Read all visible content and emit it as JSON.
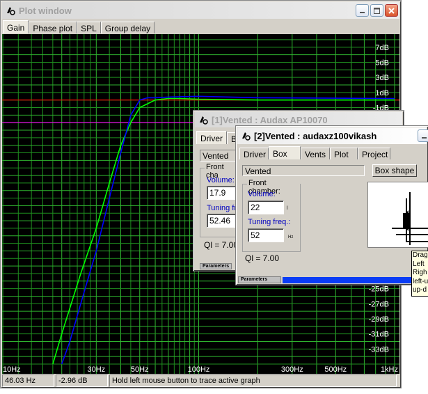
{
  "plot_window": {
    "title": "Plot window",
    "tabs": [
      "Gain",
      "Phase plot",
      "SPL",
      "Group delay"
    ],
    "y_ticks": [
      "7dB",
      "5dB",
      "3dB",
      "1dB",
      "-1dB",
      "-25dB",
      "-27dB",
      "-29dB",
      "-31dB",
      "-33dB"
    ],
    "x_ticks": [
      "10Hz",
      "30Hz",
      "50Hz",
      "100Hz",
      "300Hz",
      "500Hz",
      "1kHz"
    ],
    "status": {
      "freq": "46.03 Hz",
      "gain": "-2.96 dB",
      "hint": "Hold left mouse button to trace active graph"
    }
  },
  "chart_data": {
    "type": "line",
    "x_scale": "log",
    "xlim": [
      10,
      1000
    ],
    "ylim": [
      -35,
      8
    ],
    "series": [
      {
        "color": "#00ff00",
        "x": [
          18,
          20,
          25,
          30,
          35,
          40,
          45,
          50,
          60,
          70,
          80,
          100,
          200,
          1000
        ],
        "y": [
          -35,
          -31,
          -23,
          -17,
          -11,
          -6,
          -3,
          -1,
          0,
          0.2,
          0.2,
          0.1,
          0,
          0
        ]
      },
      {
        "color": "#0000ff",
        "x": [
          20,
          22,
          25,
          30,
          35,
          40,
          45,
          50,
          55,
          60,
          70,
          100,
          200,
          1000
        ],
        "y": [
          -35,
          -32,
          -27,
          -20,
          -13,
          -7,
          -2,
          0,
          0.3,
          0.3,
          0.4,
          0.5,
          0.3,
          0.2
        ]
      }
    ],
    "reference_lines": [
      {
        "color": "#ff0000",
        "y": 0
      },
      {
        "color": "#ff00ff",
        "y": -3
      }
    ]
  },
  "vented1": {
    "title": "[1]Vented : Audax AP10070",
    "tabs": [
      "Driver",
      "B"
    ],
    "type_value": "Vented",
    "front_chamber_label": "Front cha",
    "volume_label": "Volume:",
    "volume_value": "17.9",
    "tuning_label": "Tuning fr",
    "tuning_value": "52.46",
    "ql": "Ql = 7.00",
    "parameters_label": "Parameters"
  },
  "vented2": {
    "title": "[2]Vented : audaxz100vikash",
    "tabs": [
      "Driver",
      "Box",
      "Vents",
      "Plot",
      "Project"
    ],
    "type_value": "Vented",
    "box_shape_button": "Box shape",
    "front_chamber_label": "Front chamber:",
    "volume_label": "Volume:",
    "volume_value": "22",
    "volume_unit": "l",
    "tuning_label": "Tuning freq.:",
    "tuning_value": "52",
    "tuning_unit": "Hz",
    "ql": "Ql = 7.00",
    "parameters_label": "Parameters"
  },
  "tooltip_lines": [
    "Drag",
    "Left",
    "Righ",
    "left-u",
    "up-d"
  ]
}
